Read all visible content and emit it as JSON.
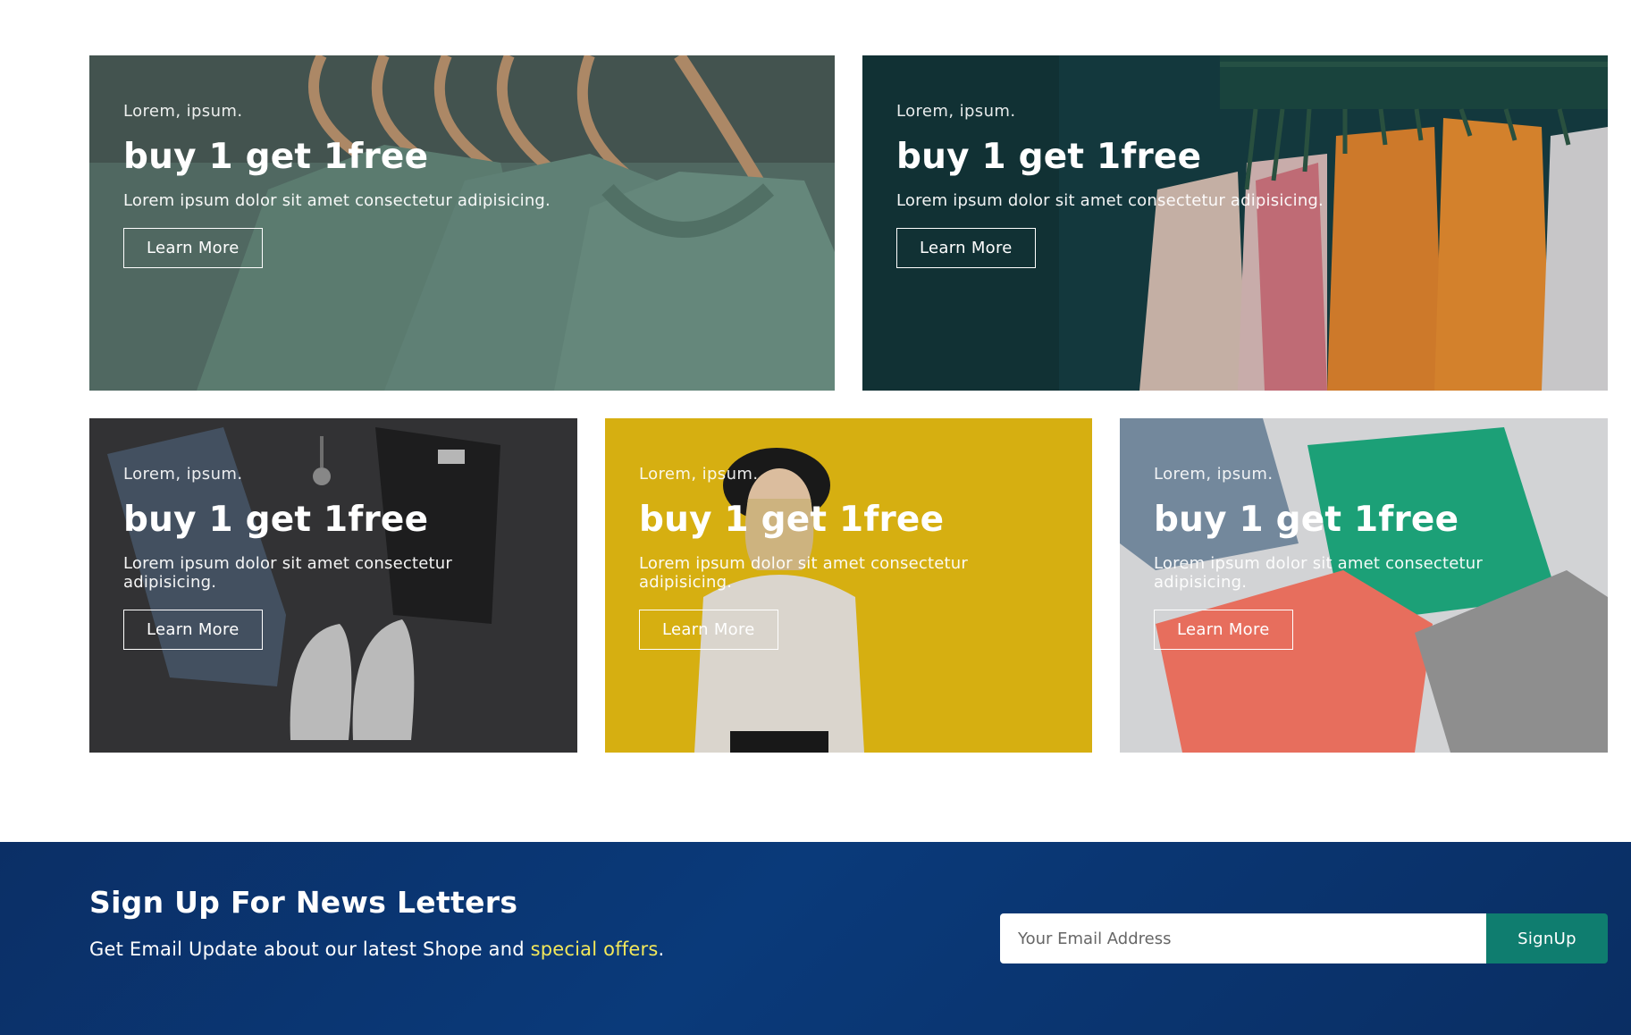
{
  "banners": [
    {
      "kicker": "Lorem, ipsum.",
      "headline": "buy 1 get 1free",
      "description": "Lorem ipsum dolor sit amet consectetur adipisicing.",
      "button": "Learn More",
      "image": "green-tshirts-on-hangers"
    },
    {
      "kicker": "Lorem, ipsum.",
      "headline": "buy 1 get 1free",
      "description": "Lorem ipsum dolor sit amet consectetur adipisicing.",
      "button": "Learn More",
      "image": "clothing-rack"
    },
    {
      "kicker": "Lorem, ipsum.",
      "headline": "buy 1 get 1free",
      "description": "Lorem ipsum dolor sit amet consectetur adipisicing.",
      "button": "Learn More",
      "image": "jeans-shirt-sneakers-flatlay"
    },
    {
      "kicker": "Lorem, ipsum.",
      "headline": "buy 1 get 1free",
      "description": "Lorem ipsum dolor sit amet consectetur adipisicing.",
      "button": "Learn More",
      "image": "woman-yellow-wall"
    },
    {
      "kicker": "Lorem, ipsum.",
      "headline": "buy 1 get 1free",
      "description": "Lorem ipsum dolor sit amet consectetur adipisicing.",
      "button": "Learn More",
      "image": "folded-polo-shirts"
    }
  ],
  "newsletter": {
    "title": "Sign Up For News Letters",
    "text_prefix": "Get Email Update about our latest Shope and ",
    "text_highlight": "special offers",
    "text_suffix": ".",
    "email_placeholder": "Your Email Address",
    "signup_label": "SignUp"
  },
  "colors": {
    "newsletter_bg": "#0a3a7a",
    "signup_button": "#0f7d6f",
    "highlight": "#f3e85a"
  }
}
